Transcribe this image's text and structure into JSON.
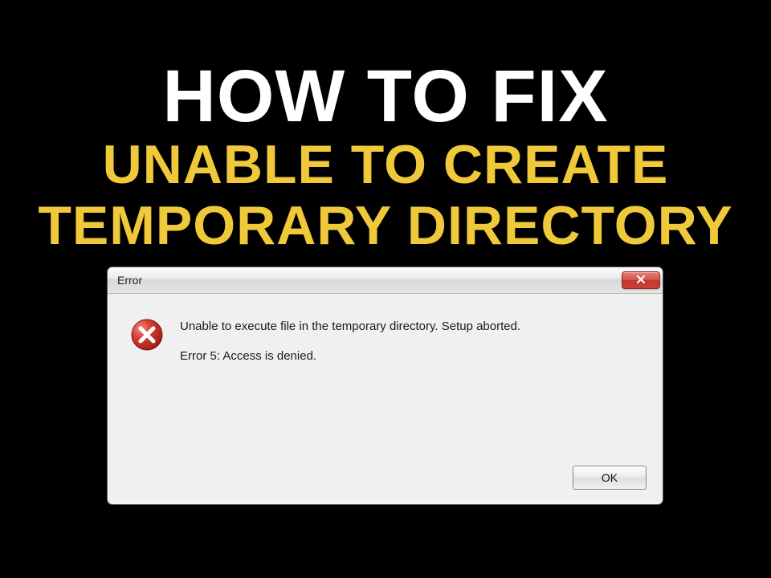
{
  "headline": {
    "line1": "HOW TO FIX",
    "line2": "UNABLE TO CREATE",
    "line3": "TEMPORARY DIRECTORY"
  },
  "dialog": {
    "title": "Error",
    "close_icon": "close-icon",
    "error_icon": "error-x-icon",
    "message_line1": "Unable to execute file in the temporary directory. Setup aborted.",
    "message_line2": "Error 5: Access is denied.",
    "ok_label": "OK"
  }
}
